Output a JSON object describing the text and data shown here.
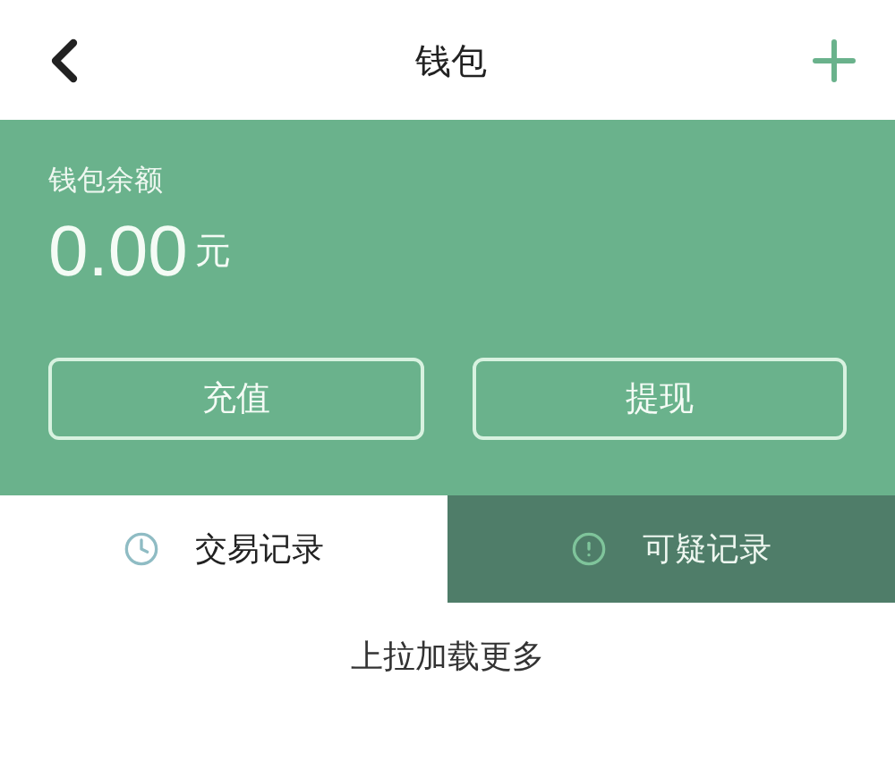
{
  "header": {
    "title": "钱包"
  },
  "balance": {
    "label": "钱包余额",
    "amount": "0.00",
    "unit": "元"
  },
  "buttons": [
    "充值",
    "提现"
  ],
  "tabs": [
    {
      "label": "交易记录",
      "kind": "clock",
      "selected": true
    },
    {
      "label": "可疑记录",
      "kind": "alert",
      "selected": false
    }
  ],
  "footer_hint": "上拉加载更多"
}
